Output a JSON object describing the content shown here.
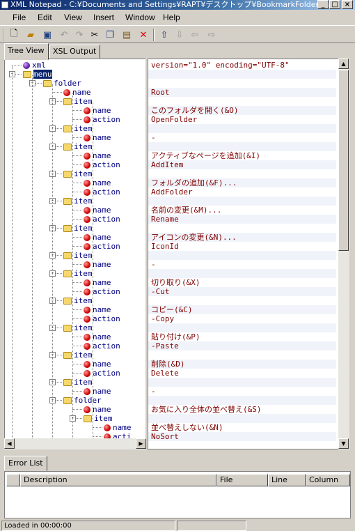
{
  "window": {
    "title": "XML Notepad - C:¥Documents and Settings¥RAPT¥デスクトップ¥BookmarkFolder.xml"
  },
  "menu": [
    "File",
    "Edit",
    "View",
    "Insert",
    "Window",
    "Help"
  ],
  "toolbar": [
    "new-icon",
    "open-icon",
    "save-icon",
    "undo-icon",
    "redo-icon",
    "cut-icon",
    "copy-icon",
    "paste-icon",
    "delete-icon",
    "nudge-up-icon",
    "nudge-down-icon",
    "nudge-left-icon",
    "nudge-right-icon"
  ],
  "tabs": {
    "tree_view": "Tree View",
    "xsl_output": "XSL Output"
  },
  "tree": [
    {
      "depth": 0,
      "kind": "pi",
      "label": "xml",
      "value": "version=\"1.0\" encoding=\"UTF-8\""
    },
    {
      "depth": 0,
      "kind": "folder",
      "label": "menu",
      "value": "",
      "selected": true,
      "expander": "-"
    },
    {
      "depth": 1,
      "kind": "folder",
      "label": "folder",
      "value": "",
      "expander": "-"
    },
    {
      "depth": 2,
      "kind": "attr",
      "label": "name",
      "value": "Root"
    },
    {
      "depth": 2,
      "kind": "folder",
      "label": "item",
      "value": "",
      "expander": "-"
    },
    {
      "depth": 3,
      "kind": "attr",
      "label": "name",
      "value": "このフォルダを開く(&O)"
    },
    {
      "depth": 3,
      "kind": "attr",
      "label": "action",
      "value": "OpenFolder"
    },
    {
      "depth": 2,
      "kind": "folder",
      "label": "item",
      "value": "",
      "expander": "-"
    },
    {
      "depth": 3,
      "kind": "attr",
      "label": "name",
      "value": "-"
    },
    {
      "depth": 2,
      "kind": "folder",
      "label": "item",
      "value": "",
      "expander": "-"
    },
    {
      "depth": 3,
      "kind": "attr",
      "label": "name",
      "value": "アクティブなページを追加(&I)"
    },
    {
      "depth": 3,
      "kind": "attr",
      "label": "action",
      "value": "AddItem"
    },
    {
      "depth": 2,
      "kind": "folder",
      "label": "item",
      "value": "",
      "expander": "-"
    },
    {
      "depth": 3,
      "kind": "attr",
      "label": "name",
      "value": "フォルダの追加(&F)..."
    },
    {
      "depth": 3,
      "kind": "attr",
      "label": "action",
      "value": "AddFolder"
    },
    {
      "depth": 2,
      "kind": "folder",
      "label": "item",
      "value": "",
      "expander": "-"
    },
    {
      "depth": 3,
      "kind": "attr",
      "label": "name",
      "value": "名前の変更(&M)..."
    },
    {
      "depth": 3,
      "kind": "attr",
      "label": "action",
      "value": "Rename"
    },
    {
      "depth": 2,
      "kind": "folder",
      "label": "item",
      "value": "",
      "expander": "-"
    },
    {
      "depth": 3,
      "kind": "attr",
      "label": "name",
      "value": "アイコンの変更(&N)..."
    },
    {
      "depth": 3,
      "kind": "attr",
      "label": "action",
      "value": "IconId"
    },
    {
      "depth": 2,
      "kind": "folder",
      "label": "item",
      "value": "",
      "expander": "-"
    },
    {
      "depth": 3,
      "kind": "attr",
      "label": "name",
      "value": "-"
    },
    {
      "depth": 2,
      "kind": "folder",
      "label": "item",
      "value": "",
      "expander": "-"
    },
    {
      "depth": 3,
      "kind": "attr",
      "label": "name",
      "value": "切り取り(&X)"
    },
    {
      "depth": 3,
      "kind": "attr",
      "label": "action",
      "value": "-Cut"
    },
    {
      "depth": 2,
      "kind": "folder",
      "label": "item",
      "value": "",
      "expander": "-"
    },
    {
      "depth": 3,
      "kind": "attr",
      "label": "name",
      "value": "コピー(&C)"
    },
    {
      "depth": 3,
      "kind": "attr",
      "label": "action",
      "value": "-Copy"
    },
    {
      "depth": 2,
      "kind": "folder",
      "label": "item",
      "value": "",
      "expander": "-"
    },
    {
      "depth": 3,
      "kind": "attr",
      "label": "name",
      "value": "貼り付け(&P)"
    },
    {
      "depth": 3,
      "kind": "attr",
      "label": "action",
      "value": "-Paste"
    },
    {
      "depth": 2,
      "kind": "folder",
      "label": "item",
      "value": "",
      "expander": "-"
    },
    {
      "depth": 3,
      "kind": "attr",
      "label": "name",
      "value": "削除(&D)"
    },
    {
      "depth": 3,
      "kind": "attr",
      "label": "action",
      "value": "Delete"
    },
    {
      "depth": 2,
      "kind": "folder",
      "label": "item",
      "value": "",
      "expander": "-"
    },
    {
      "depth": 3,
      "kind": "attr",
      "label": "name",
      "value": "-"
    },
    {
      "depth": 2,
      "kind": "folder",
      "label": "folder",
      "value": "",
      "expander": "-"
    },
    {
      "depth": 3,
      "kind": "attr",
      "label": "name",
      "value": "お気に入り全体の並べ替え(&S)"
    },
    {
      "depth": 3,
      "kind": "folder",
      "label": "item",
      "value": "",
      "expander": "-"
    },
    {
      "depth": 4,
      "kind": "attr",
      "label": "name",
      "value": "並べ替えしない(&N)"
    },
    {
      "depth": 4,
      "kind": "attr",
      "label": "acti",
      "value": "NoSort"
    }
  ],
  "error_list": {
    "tab": "Error List",
    "columns": [
      "Description",
      "File",
      "Line",
      "Column"
    ]
  },
  "status": {
    "text": "Loaded in 00:00:00"
  }
}
